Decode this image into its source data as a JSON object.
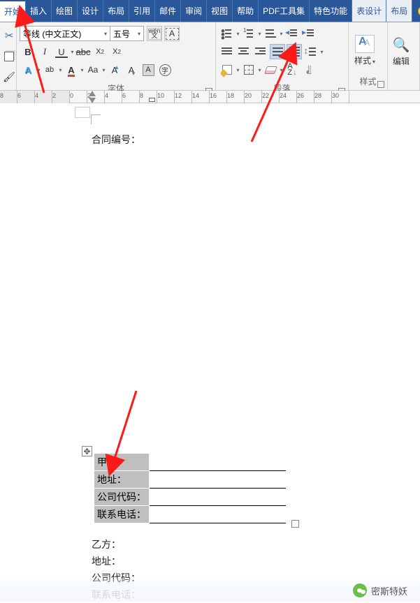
{
  "tabs": [
    "开始",
    "插入",
    "绘图",
    "设计",
    "布局",
    "引用",
    "邮件",
    "审阅",
    "视图",
    "帮助",
    "PDF工具集",
    "特色功能",
    "表设计",
    "布局"
  ],
  "activeTabIndex": 0,
  "font": {
    "name": "等线 (中文正文)",
    "size": "五号"
  },
  "groups": {
    "font": "字体",
    "paragraph": "段落",
    "styles": "样式",
    "edit": "编辑"
  },
  "styleBtn": "样式",
  "ruler": {
    "start": -8,
    "end": 30,
    "step": 2
  },
  "doc": {
    "contractLabel": "合同编号：",
    "partyA": {
      "rows": [
        "甲方：",
        "地址：",
        "公司代码：",
        "联系电话："
      ]
    },
    "partyB": {
      "rows": [
        "乙方：",
        "地址：",
        "公司代码：",
        "联系电话："
      ]
    }
  },
  "watermark": "密斯特妖"
}
